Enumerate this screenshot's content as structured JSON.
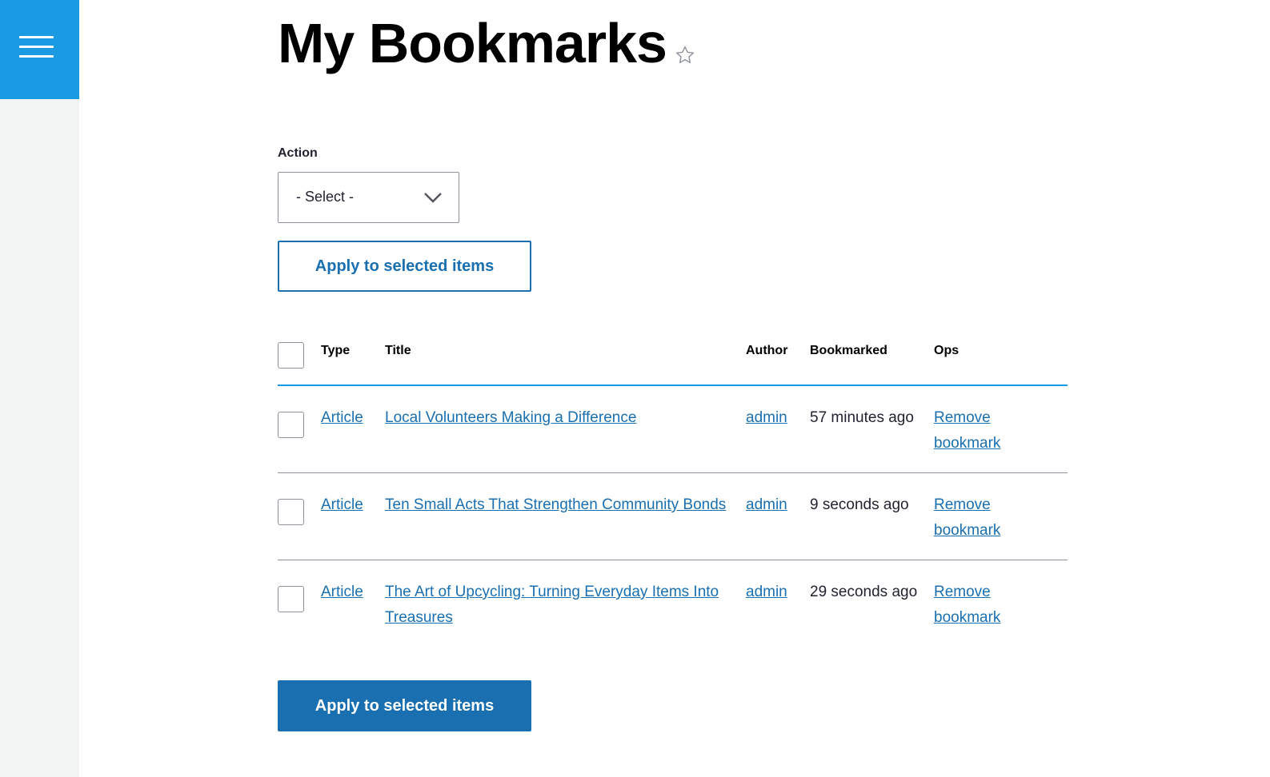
{
  "sidebar": {
    "menu_icon": "hamburger-menu-icon",
    "accent_color": "#1b9ae4"
  },
  "page": {
    "title": "My Bookmarks",
    "star_icon": "star-outline-icon"
  },
  "action": {
    "label": "Action",
    "select_value": "- Select -",
    "apply_top_label": "Apply to selected items",
    "apply_bottom_label": "Apply to selected items"
  },
  "table": {
    "headers": {
      "type": "Type",
      "title": "Title",
      "author": "Author",
      "bookmarked": "Bookmarked",
      "ops": "Ops"
    },
    "rows": [
      {
        "type": "Article",
        "title": "Local Volunteers Making a Difference",
        "author": "admin",
        "bookmarked": "57 minutes ago",
        "ops": "Remove bookmark"
      },
      {
        "type": "Article",
        "title": "Ten Small Acts That Strengthen Community Bonds",
        "author": "admin",
        "bookmarked": "9 seconds ago",
        "ops": "Remove bookmark"
      },
      {
        "type": "Article",
        "title": "The Art of Upcycling: Turning Everyday Items Into Treasures",
        "author": "admin",
        "bookmarked": "29 seconds ago",
        "ops": "Remove bookmark"
      }
    ]
  },
  "colors": {
    "link": "#1a6fb0",
    "primary_button": "#1a6fb0",
    "header_rule": "#1b9ae4"
  }
}
